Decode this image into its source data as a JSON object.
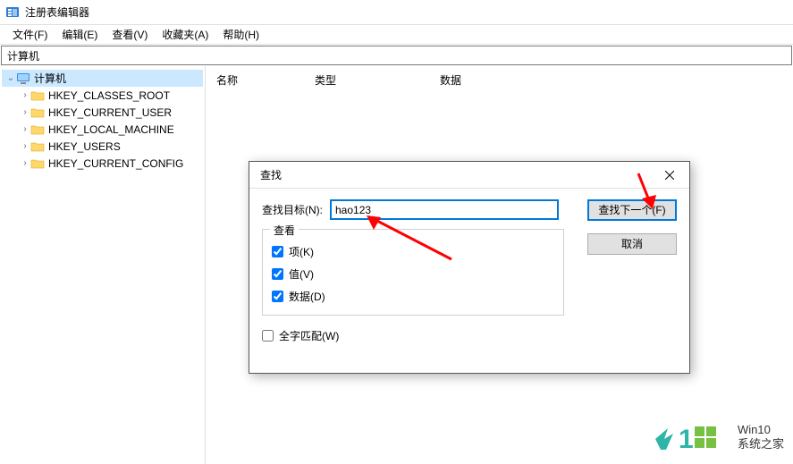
{
  "window": {
    "title": "注册表编辑器"
  },
  "menu": {
    "file": "文件(F)",
    "edit": "编辑(E)",
    "view": "查看(V)",
    "favorites": "收藏夹(A)",
    "help": "帮助(H)"
  },
  "address": {
    "path": "计算机"
  },
  "tree": {
    "root": "计算机",
    "keys": [
      "HKEY_CLASSES_ROOT",
      "HKEY_CURRENT_USER",
      "HKEY_LOCAL_MACHINE",
      "HKEY_USERS",
      "HKEY_CURRENT_CONFIG"
    ]
  },
  "list": {
    "col_name": "名称",
    "col_type": "类型",
    "col_data": "数据"
  },
  "dialog": {
    "title": "查找",
    "target_label": "查找目标(N):",
    "target_value": "hao123",
    "group_view": "查看",
    "cb_key": "项(K)",
    "cb_value": "值(V)",
    "cb_data": "数据(D)",
    "cb_fullword": "全字匹配(W)",
    "btn_findnext": "查找下一个(F)",
    "btn_cancel": "取消"
  },
  "watermark": {
    "brand": "Win10",
    "sub": "系统之家"
  }
}
